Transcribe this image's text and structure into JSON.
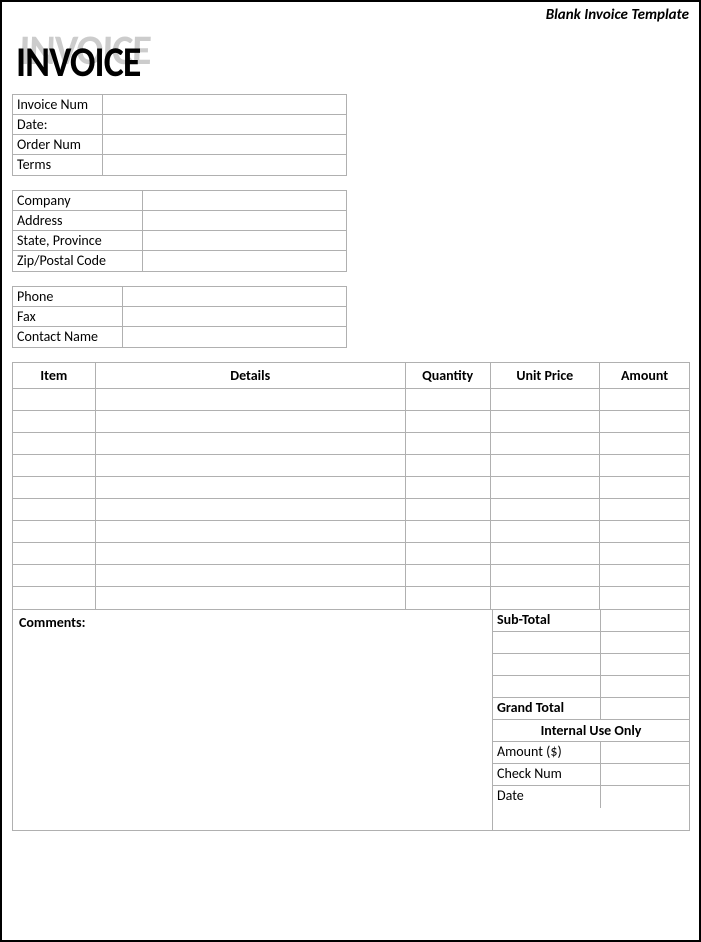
{
  "header": {
    "note": "Blank Invoice Template",
    "logo": "INVOICE"
  },
  "info": {
    "invoice_num_label": "Invoice Num",
    "invoice_num": "",
    "date_label": "Date:",
    "date": "",
    "order_num_label": "Order Num",
    "order_num": "",
    "terms_label": "Terms",
    "terms": ""
  },
  "company": {
    "company_label": "Company",
    "company": "",
    "address_label": "Address",
    "address": "",
    "state_label": "State, Province",
    "state": "",
    "zip_label": "Zip/Postal Code",
    "zip": ""
  },
  "contact": {
    "phone_label": "Phone",
    "phone": "",
    "fax_label": "Fax",
    "fax": "",
    "contact_name_label": "Contact Name",
    "contact_name": ""
  },
  "items": {
    "headers": {
      "item": "Item",
      "details": "Details",
      "quantity": "Quantity",
      "unit_price": "Unit Price",
      "amount": "Amount"
    },
    "rows": [
      {
        "item": "",
        "details": "",
        "quantity": "",
        "unit_price": "",
        "amount": ""
      },
      {
        "item": "",
        "details": "",
        "quantity": "",
        "unit_price": "",
        "amount": ""
      },
      {
        "item": "",
        "details": "",
        "quantity": "",
        "unit_price": "",
        "amount": ""
      },
      {
        "item": "",
        "details": "",
        "quantity": "",
        "unit_price": "",
        "amount": ""
      },
      {
        "item": "",
        "details": "",
        "quantity": "",
        "unit_price": "",
        "amount": ""
      },
      {
        "item": "",
        "details": "",
        "quantity": "",
        "unit_price": "",
        "amount": ""
      },
      {
        "item": "",
        "details": "",
        "quantity": "",
        "unit_price": "",
        "amount": ""
      },
      {
        "item": "",
        "details": "",
        "quantity": "",
        "unit_price": "",
        "amount": ""
      },
      {
        "item": "",
        "details": "",
        "quantity": "",
        "unit_price": "",
        "amount": ""
      },
      {
        "item": "",
        "details": "",
        "quantity": "",
        "unit_price": "",
        "amount": ""
      }
    ]
  },
  "comments_label": "Comments:",
  "totals": {
    "subtotal_label": "Sub-Total",
    "subtotal": "",
    "row2_label": "",
    "row2_value": "",
    "row3_label": "",
    "row3_value": "",
    "row4_label": "",
    "row4_value": "",
    "grand_total_label": "Grand Total",
    "grand_total": "",
    "internal_header": "Internal Use Only",
    "amount_label": "Amount ($)",
    "amount": "",
    "check_label": "Check Num",
    "check": "",
    "date_label": "Date",
    "date": ""
  }
}
